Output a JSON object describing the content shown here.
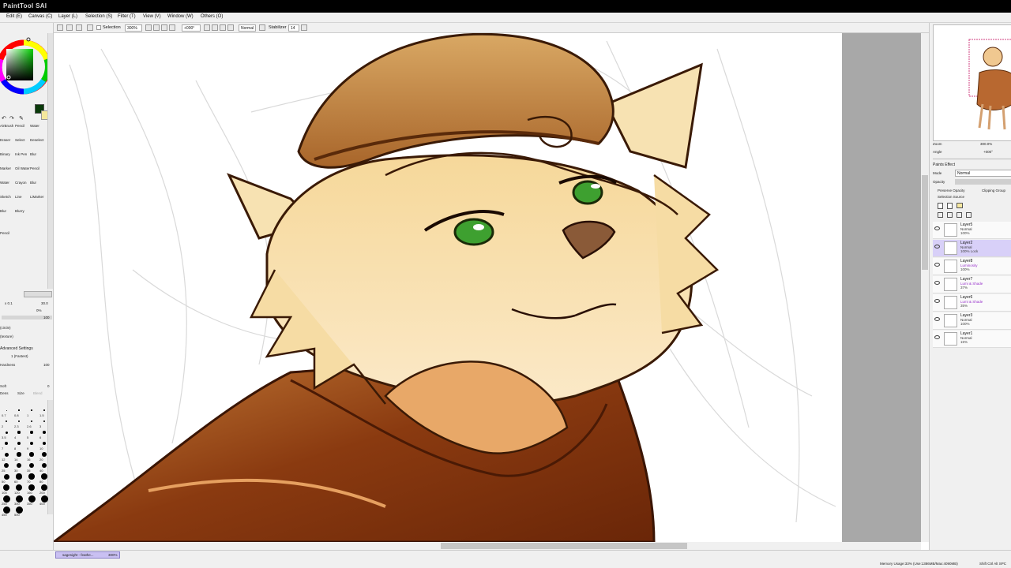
{
  "app": {
    "title": "PaintTool SAI"
  },
  "menubar": {
    "items": [
      "Edit (E)",
      "Canvas (C)",
      "Layer (L)",
      "Selection (S)",
      "Filter (T)",
      "View (V)",
      "Window (W)",
      "Others (O)"
    ]
  },
  "toolbar": {
    "selection_label": "Selection",
    "zoom": "300%",
    "angle": "+000°",
    "blend": "Normal",
    "stabilizer_label": "Stabilizer",
    "stabilizer_value": "14"
  },
  "left_panel": {
    "tools": [
      "AirBrush",
      "Pencil",
      "Water",
      "Eraser",
      "Select",
      "Deselect",
      "Binary",
      "Ink Pen",
      "Blur",
      "Marker",
      "Oil Water",
      "Pencil",
      "Water",
      "Crayon",
      "Blur",
      "Sketch",
      "Line",
      "LiMarker",
      "Blur",
      "Blurry",
      "Pencil"
    ],
    "max_size": "x 0.1",
    "size_value": "30.0",
    "min_size": "0%",
    "density": "100",
    "shape_label": "(circle)",
    "texture_label": "(texture)",
    "advanced_label": "Advanced Settings",
    "quality": "1 (Fastest)",
    "hardness_label": "Hardness",
    "hardness_value": "100",
    "soft_label": "Soft",
    "soft_value": "0",
    "size_check_label": "Size",
    "dens_label": "Dens",
    "blend_label": "Blend",
    "brush_sizes": [
      "0.7",
      "0.8",
      "1",
      "1.5",
      "2",
      "2.3",
      "2.6",
      "3",
      "3.5",
      "4",
      "5",
      "6",
      "7",
      "8",
      "9",
      "10",
      "12",
      "14",
      "16",
      "20",
      "25",
      "30",
      "35",
      "40",
      "50",
      "60",
      "70",
      "80",
      "100",
      "120",
      "160",
      "200",
      "250",
      "300",
      "350",
      "400",
      "450",
      "500"
    ]
  },
  "navigator": {
    "zoom_label": "Zoom",
    "zoom_value": "300.0%",
    "angle_label": "Angle",
    "angle_value": "+000°"
  },
  "layer_panel": {
    "paper_effect_label": "Paints Effect",
    "mode_label": "Mode",
    "mode_value": "Normal",
    "opacity_label": "Opacity",
    "preserve_opacity_label": "Preserve Opacity",
    "clipping_group_label": "Clipping Group",
    "selection_source_label": "Selection Source",
    "layers": [
      {
        "name": "Layer5",
        "mode": "Normal",
        "opacity": "100%",
        "selected": false
      },
      {
        "name": "Layer2",
        "mode": "Normal",
        "opacity": "100% Lock",
        "selected": true
      },
      {
        "name": "Layer8",
        "mode": "Luminosity",
        "opacity": "100%",
        "selected": false
      },
      {
        "name": "Layer7",
        "mode": "Lumi & Shade",
        "opacity": "37%",
        "selected": false
      },
      {
        "name": "Layer6",
        "mode": "Lumi & Shade",
        "opacity": "35%",
        "selected": false
      },
      {
        "name": "Layer3",
        "mode": "Normal",
        "opacity": "100%",
        "selected": false
      },
      {
        "name": "Layer1",
        "mode": "Normal",
        "opacity": "15%",
        "selected": false
      }
    ]
  },
  "taskbar": {
    "doc_tab": "sagesight - feathe...",
    "doc_zoom": "300%"
  },
  "status": {
    "memory": "Memory Usage:33% (Use:1386MB/Max:4090MB)",
    "keys": "Shift Ctrl Alt SPC"
  },
  "colors": {
    "panel_bg": "#f0f0f0",
    "selected_layer": "#d8d0f8",
    "primary_color": "#0a3a0a",
    "secondary_color": "#f4e89c",
    "mode_purple": "#9933cc"
  }
}
